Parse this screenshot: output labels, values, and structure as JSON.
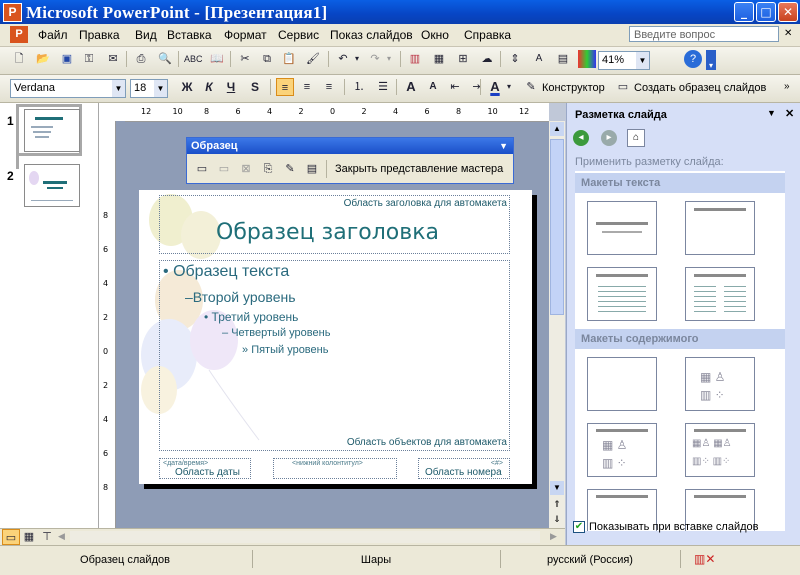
{
  "window": {
    "title": "Microsoft PowerPoint - [Презентация1]",
    "min": "_",
    "max": "□",
    "close": "✕"
  },
  "menu": {
    "items": [
      "Файл",
      "Правка",
      "Вид",
      "Вставка",
      "Формат",
      "Сервис",
      "Показ слайдов",
      "Окно",
      "Справка"
    ],
    "help_placeholder": "Введите вопрос"
  },
  "toolbar_standard": {
    "zoom": "41%"
  },
  "toolbar_format": {
    "font": "Verdana",
    "size": "18",
    "bold": "Ж",
    "italic": "К",
    "underline": "Ч",
    "shadow": "S",
    "designer": "Конструктор",
    "new_master": "Создать образец слайдов"
  },
  "slides": [
    {
      "num": "1"
    },
    {
      "num": "2"
    }
  ],
  "ruler": {
    "h": [
      "12",
      "10",
      "8",
      "6",
      "4",
      "2",
      "0",
      "2",
      "4",
      "6",
      "8",
      "10",
      "12"
    ],
    "v": [
      "8",
      "6",
      "4",
      "2",
      "0",
      "2",
      "4",
      "6",
      "8"
    ]
  },
  "master_toolbar": {
    "title": "Образец",
    "close_view": "Закрыть представление мастера"
  },
  "slide": {
    "title_area_label": "Область заголовка для автомакета",
    "title": "Образец заголовка",
    "levels": [
      "Образец текста",
      "Второй уровень",
      "Третий уровень",
      "Четвертый уровень",
      "Пятый уровень"
    ],
    "bullets": [
      "•",
      "–",
      "•",
      "–",
      "»"
    ],
    "body_area_label": "Область объектов для автомакета",
    "date_small": "<дата/время>",
    "date_label": "Область даты",
    "footer_small": "<нижний колонтитул>",
    "number_small": "<#>",
    "number_label": "Область номера"
  },
  "taskpane": {
    "title": "Разметка слайда",
    "apply_label": "Применить разметку слайда:",
    "text_layouts": "Макеты текста",
    "content_layouts": "Макеты содержимого",
    "show_on_insert": "Показывать при вставке слайдов",
    "show_checked": true
  },
  "status": {
    "view": "Образец слайдов",
    "design": "Шары",
    "language": "русский (Россия)"
  },
  "colors": {
    "title_teal": "#1f6f78",
    "text_teal": "#2a6a7e",
    "xp_blue": "#0a5fe4"
  }
}
